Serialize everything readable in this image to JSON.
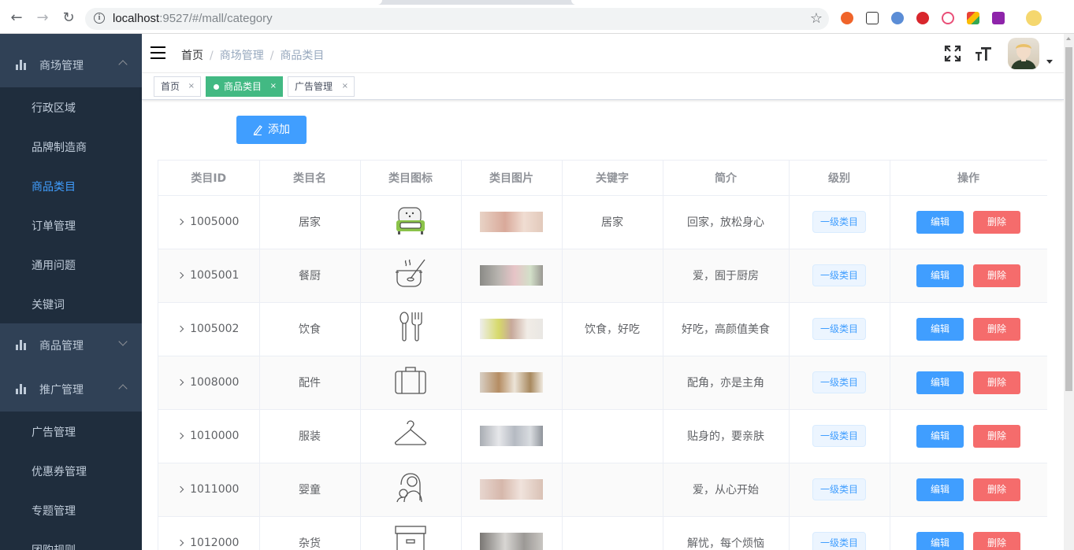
{
  "browser": {
    "url_host": "localhost",
    "url_rest": ":9527/#/mall/category"
  },
  "sidebar": {
    "groups": [
      {
        "label": "商场管理",
        "expanded": true
      },
      {
        "label": "商品管理",
        "expanded": false
      },
      {
        "label": "推广管理",
        "expanded": true
      }
    ],
    "mall_items": [
      {
        "label": "行政区域",
        "active": false
      },
      {
        "label": "品牌制造商",
        "active": false
      },
      {
        "label": "商品类目",
        "active": true
      },
      {
        "label": "订单管理",
        "active": false
      },
      {
        "label": "通用问题",
        "active": false
      },
      {
        "label": "关键词",
        "active": false
      }
    ],
    "promo_items": [
      {
        "label": "广告管理"
      },
      {
        "label": "优惠券管理"
      },
      {
        "label": "专题管理"
      },
      {
        "label": "团购规则"
      }
    ]
  },
  "breadcrumb": [
    "首页",
    "商场管理",
    "商品类目"
  ],
  "tags": [
    {
      "label": "首页",
      "active": false
    },
    {
      "label": "商品类目",
      "active": true
    },
    {
      "label": "广告管理",
      "active": false
    }
  ],
  "toolbar": {
    "add_label": "添加"
  },
  "table": {
    "headers": [
      "类目ID",
      "类目名",
      "类目图标",
      "类目图片",
      "关键字",
      "简介",
      "级别",
      "操作"
    ],
    "edit_label": "编辑",
    "delete_label": "删除",
    "rows": [
      {
        "id": "1005000",
        "name": "居家",
        "icon": "sofa-icon",
        "keywords": "居家",
        "desc": "回家，放松身心",
        "level": "一级类目"
      },
      {
        "id": "1005001",
        "name": "餐厨",
        "icon": "pot-icon",
        "keywords": "",
        "desc": "爱，囿于厨房",
        "level": "一级类目"
      },
      {
        "id": "1005002",
        "name": "饮食",
        "icon": "spoon-fork-icon",
        "keywords": "饮食，好吃",
        "desc": "好吃，高颜值美食",
        "level": "一级类目"
      },
      {
        "id": "1008000",
        "name": "配件",
        "icon": "suitcase-icon",
        "keywords": "",
        "desc": "配角，亦是主角",
        "level": "一级类目"
      },
      {
        "id": "1010000",
        "name": "服装",
        "icon": "hanger-icon",
        "keywords": "",
        "desc": "贴身的，要亲肤",
        "level": "一级类目"
      },
      {
        "id": "1011000",
        "name": "婴童",
        "icon": "mother-child-icon",
        "keywords": "",
        "desc": "爱，从心开始",
        "level": "一级类目"
      },
      {
        "id": "1012000",
        "name": "杂货",
        "icon": "storage-box-icon",
        "keywords": "",
        "desc": "解忧，每个烦恼",
        "level": "一级类目"
      }
    ]
  }
}
